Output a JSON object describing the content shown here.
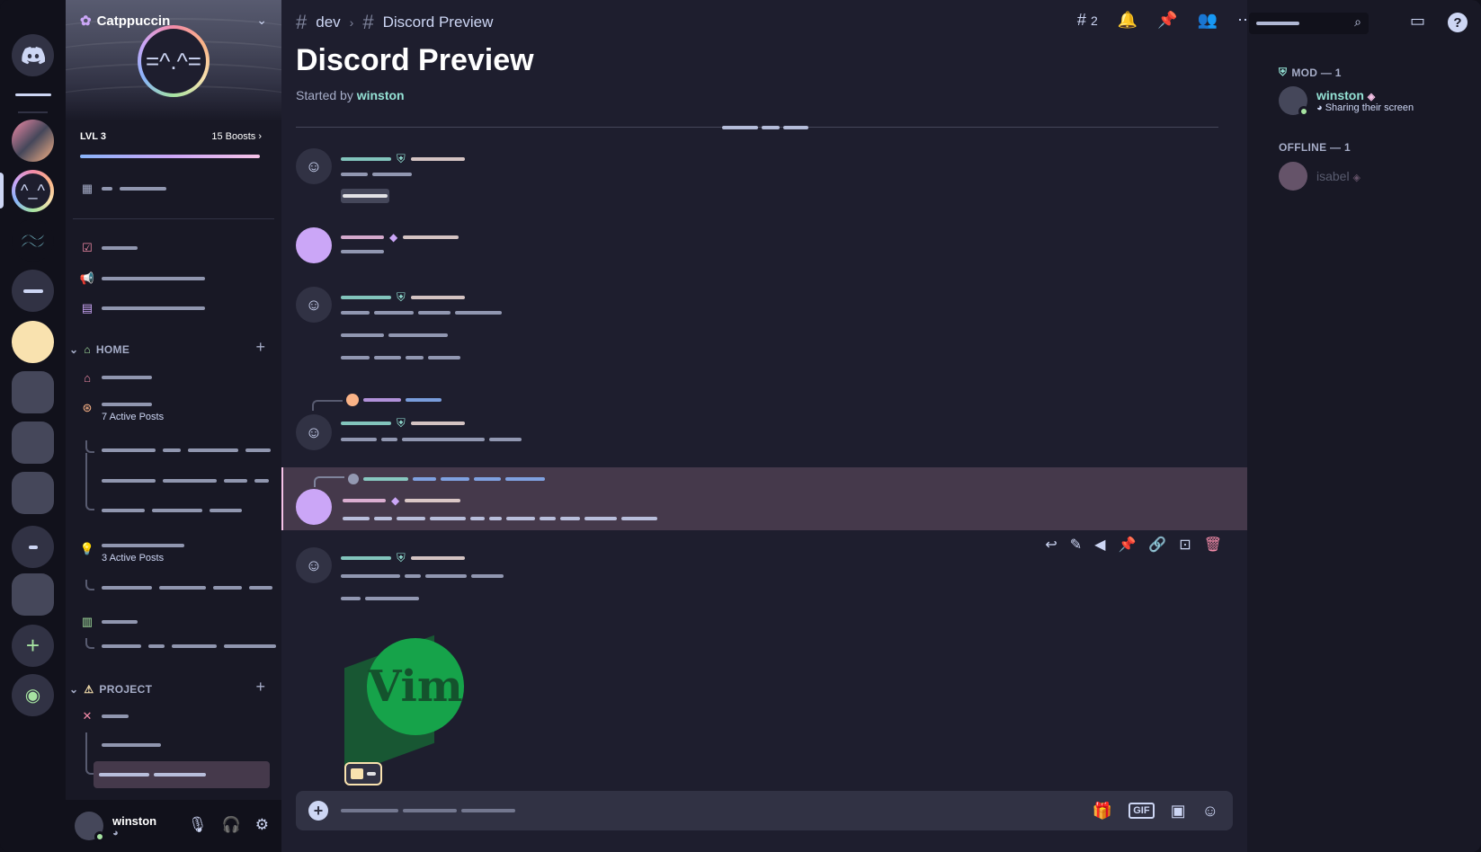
{
  "window": {
    "traffic_colors": [
      "#ff5f57",
      "#febc2e",
      "#28c840"
    ]
  },
  "server": {
    "name": "Catppuccin",
    "level": "LVL 3",
    "boosts": "15 Boosts"
  },
  "categories": [
    {
      "name": "HOME"
    },
    {
      "name": "PROJECT"
    }
  ],
  "forums": [
    {
      "active_posts": "7 Active Posts"
    },
    {
      "active_posts": "3 Active Posts"
    }
  ],
  "user": {
    "name": "winston"
  },
  "header": {
    "channel": "dev",
    "thread": "Discord Preview",
    "threads_count": "2"
  },
  "post": {
    "title": "Discord Preview",
    "started_by_prefix": "Started by ",
    "author": "winston"
  },
  "sticker_label": "Vim",
  "compose": {
    "gif_label": "GIF"
  },
  "members": {
    "groups": [
      {
        "title": "MOD — 1",
        "members": [
          {
            "name": "winston",
            "status": "Sharing their screen",
            "online": true
          }
        ]
      },
      {
        "title": "OFFLINE — 1",
        "members": [
          {
            "name": "isabel",
            "online": false
          }
        ]
      }
    ]
  },
  "colors": {
    "base": "#1e1e2e",
    "mantle": "#181825",
    "crust": "#11111b",
    "accent_pink": "#f5c2e7",
    "teal": "#94e2d5",
    "mauve": "#cba6f7",
    "green": "#a6e3a1"
  }
}
